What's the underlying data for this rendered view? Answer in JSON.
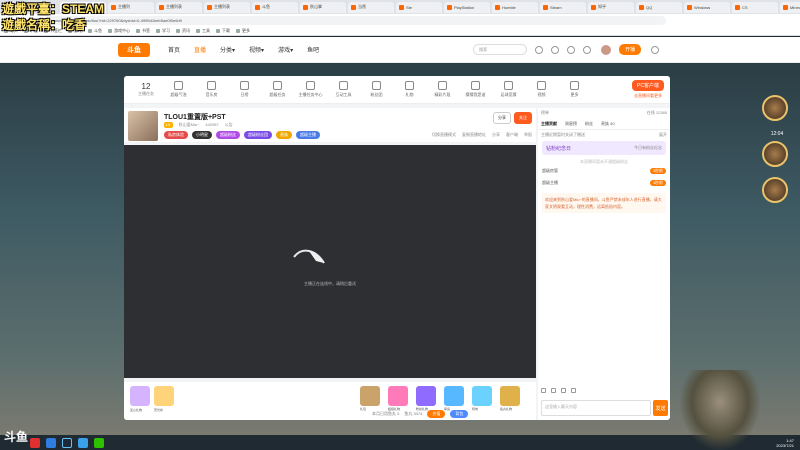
{
  "overlay": {
    "line1": "遊戲平臺：STEAM",
    "line2": "遊戲名稱：吃香"
  },
  "browser": {
    "tabs": [
      "斗鱼直播",
      "主播列",
      "主播列表",
      "主播列表",
      "斗鱼",
      "秋山掌",
      "当然",
      "Ste",
      "PlayStation",
      "Humble",
      "Steam",
      "知乎",
      "QQ",
      "Windows",
      "CS",
      "Minecraft"
    ],
    "url": "www.douyu.com/topic/tlou?rid=229760&dyshid=0-4995d1beb5ae0f0e6d9"
  },
  "bookmarks": [
    "导入",
    "书签",
    "书签栏",
    "游戏",
    "斗鱼",
    "游戏中心",
    "书签",
    "学习",
    "资讯",
    "工具",
    "下载",
    "更多"
  ],
  "header": {
    "logo": "斗鱼",
    "nav": [
      "首页",
      "直播",
      "分类▾",
      "视频▾",
      "游戏▾",
      "鱼吧"
    ],
    "search_placeholder": "搜索",
    "open_btn": "开播"
  },
  "toolbar": {
    "count": "12",
    "count_label": "主播任务",
    "items": [
      "超级气泡",
      "音乐房",
      "日榜",
      "超级任务",
      "主播任务中心",
      "互动工具",
      "粉丝团",
      "礼物",
      "精彩片段",
      "猜猜我是谁",
      "足球竞猜",
      "视频",
      "更多"
    ],
    "pc_btn": "PC客户端",
    "pc_sub": "去直播间看更多"
  },
  "room": {
    "title": "TLOU1重置版+PST",
    "sub1": "秋山爱Miu~",
    "sub2": "442957",
    "sub3": "公告",
    "level": "LV",
    "badges": [
      "私房体验",
      "小明星",
      "超级粉丝",
      "超级粉丝团",
      "贵族",
      "超级主播"
    ],
    "action1": "分享",
    "follow": "关注",
    "links": [
      "切换直播模式",
      "复制直播地址",
      "分享",
      "客户端",
      "举报"
    ]
  },
  "player": {
    "message": "主播正在连线中，请稍后重试"
  },
  "giftbar": {
    "left1": "爱心礼物",
    "left2": "荧光棒",
    "right": [
      "礼包",
      "超级礼物",
      "粉丝礼物",
      "幸运",
      "特效",
      "鱼丸礼物"
    ],
    "bottom_text": "本月已用鱼丸 0",
    "fish": "鱼丸 3474",
    "pill1": "充值",
    "pill2": "背包"
  },
  "chat": {
    "top_left": "榜单",
    "top_right": "在线 12385",
    "tabs": [
      "主播贡献",
      "周星榜",
      "粉丝",
      "贵族 40"
    ],
    "notice": "主播近期暂时关闭了赠送",
    "notice_right": "展开",
    "event": "钻粉纪念日",
    "event_sub": "今日有粉丝纪念",
    "hint": "本直播间暂未开通超级粉丝",
    "row1": "超级房管",
    "row1_tag": "3秒前",
    "row2": "超级主播",
    "row2_tag": "3秒前",
    "welcome": "欢迎来到秋山爱Miu~的直播间，斗鱼严禁未成年人进行直播，请大家文明观看互动，理性消费，远离低俗内容。",
    "input_placeholder": "这里输入聊天内容",
    "send": "发送"
  },
  "right_panel": {
    "time": "12:04"
  },
  "taskbar": {
    "clock1": "1:47",
    "clock2": "2023/7/21"
  },
  "watermark": "斗鱼"
}
